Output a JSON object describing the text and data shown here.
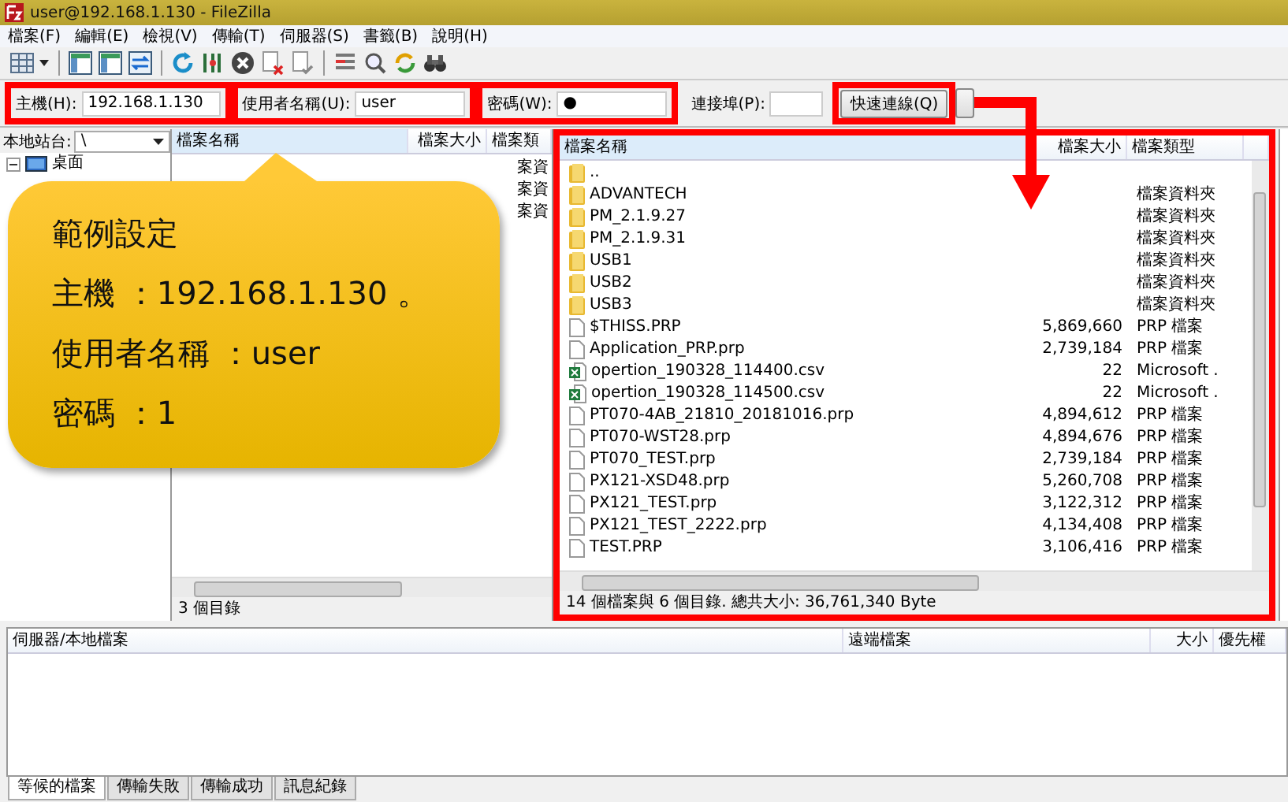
{
  "window": {
    "title": "user@192.168.1.130 - FileZilla"
  },
  "menu": [
    "檔案(F)",
    "編輯(E)",
    "檢視(V)",
    "傳輸(T)",
    "伺服器(S)",
    "書籤(B)",
    "說明(H)"
  ],
  "quickconnect": {
    "host_label": "主機(H):",
    "host": "192.168.1.130",
    "user_label": "使用者名稱(U):",
    "user": "user",
    "password_label": "密碼(W):",
    "password": "●",
    "port_label": "連接埠(P):",
    "button": "快速連線(Q)"
  },
  "local": {
    "site_label": "本地站台:",
    "path": "\\",
    "tree": [
      {
        "label": "桌面",
        "expanded": true
      }
    ],
    "columns": [
      "檔案名稱",
      "檔案大小",
      "檔案類"
    ],
    "rows": [
      {
        "type": "案資"
      },
      {
        "type": "案資"
      },
      {
        "type": "案資"
      }
    ],
    "status": "3 個目錄"
  },
  "remote": {
    "columns": [
      "檔案名稱",
      "檔案大小",
      "檔案類型"
    ],
    "rows": [
      {
        "kind": "folder",
        "name": "..",
        "size": "",
        "type": ""
      },
      {
        "kind": "folder",
        "name": "ADVANTECH",
        "size": "",
        "type": "檔案資料夾"
      },
      {
        "kind": "folder",
        "name": "PM_2.1.9.27",
        "size": "",
        "type": "檔案資料夾"
      },
      {
        "kind": "folder",
        "name": "PM_2.1.9.31",
        "size": "",
        "type": "檔案資料夾"
      },
      {
        "kind": "folder",
        "name": "USB1",
        "size": "",
        "type": "檔案資料夾"
      },
      {
        "kind": "folder",
        "name": "USB2",
        "size": "",
        "type": "檔案資料夾"
      },
      {
        "kind": "folder",
        "name": "USB3",
        "size": "",
        "type": "檔案資料夾"
      },
      {
        "kind": "file",
        "name": "$THISS.PRP",
        "size": "5,869,660",
        "type": "PRP 檔案"
      },
      {
        "kind": "file",
        "name": "Application_PRP.prp",
        "size": "2,739,184",
        "type": "PRP 檔案"
      },
      {
        "kind": "sheet",
        "name": "opertion_190328_114400.csv",
        "size": "22",
        "type": "Microsoft ."
      },
      {
        "kind": "sheet",
        "name": "opertion_190328_114500.csv",
        "size": "22",
        "type": "Microsoft ."
      },
      {
        "kind": "file",
        "name": "PT070-4AB_21810_20181016.prp",
        "size": "4,894,612",
        "type": "PRP 檔案"
      },
      {
        "kind": "file",
        "name": "PT070-WST28.prp",
        "size": "4,894,676",
        "type": "PRP 檔案"
      },
      {
        "kind": "file",
        "name": "PT070_TEST.prp",
        "size": "2,739,184",
        "type": "PRP 檔案"
      },
      {
        "kind": "file",
        "name": "PX121-XSD48.prp",
        "size": "5,260,708",
        "type": "PRP 檔案"
      },
      {
        "kind": "file",
        "name": "PX121_TEST.prp",
        "size": "3,122,312",
        "type": "PRP 檔案"
      },
      {
        "kind": "file",
        "name": "PX121_TEST_2222.prp",
        "size": "4,134,408",
        "type": "PRP 檔案"
      },
      {
        "kind": "file",
        "name": "TEST.PRP",
        "size": "3,106,416",
        "type": "PRP 檔案"
      }
    ],
    "status": "14 個檔案與 6 個目錄. 總共大小: 36,761,340 Byte"
  },
  "queue": {
    "columns": [
      "伺服器/本地檔案",
      "遠端檔案",
      "大小",
      "優先權"
    ],
    "tabs": [
      {
        "label": "等候的檔案",
        "selected": true
      },
      {
        "label": "傳輸失敗",
        "selected": false
      },
      {
        "label": "傳輸成功",
        "selected": false
      },
      {
        "label": "訊息紀錄",
        "selected": false
      }
    ]
  },
  "callout": {
    "lines": [
      "範例設定",
      "主機 ：192.168.1.130 。",
      "使用者名稱 ：user",
      "密碼 ：1"
    ]
  }
}
